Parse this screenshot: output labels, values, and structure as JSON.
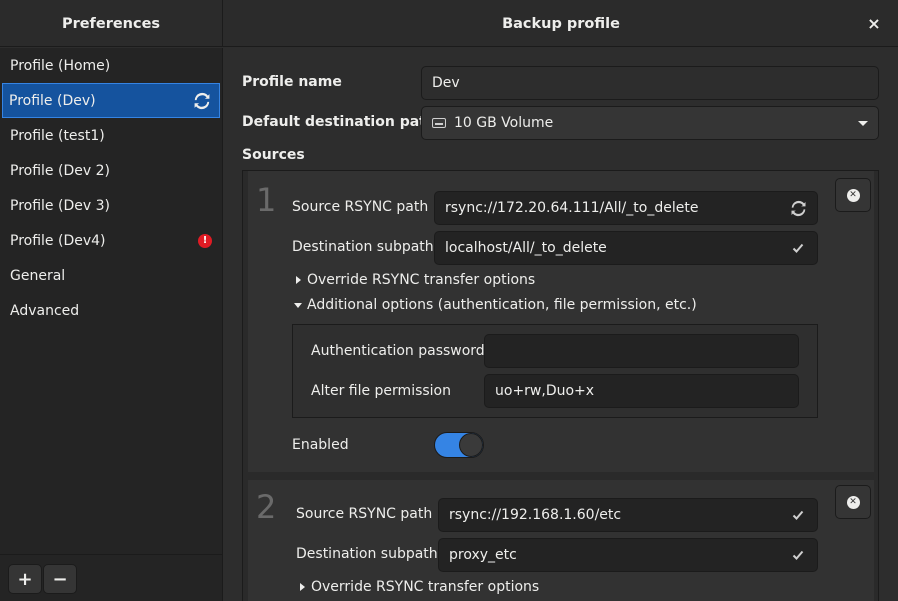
{
  "window": {
    "sidebar_title": "Preferences",
    "main_title": "Backup profile",
    "close_label": "×"
  },
  "sidebar": {
    "items": [
      {
        "label": "Profile (Home)",
        "selected": false,
        "status": ""
      },
      {
        "label": "Profile (Dev)",
        "selected": true,
        "status": "sync-icon"
      },
      {
        "label": "Profile (test1)",
        "selected": false,
        "status": ""
      },
      {
        "label": "Profile (Dev 2)",
        "selected": false,
        "status": ""
      },
      {
        "label": "Profile (Dev 3)",
        "selected": false,
        "status": ""
      },
      {
        "label": "Profile (Dev4)",
        "selected": false,
        "status": "error-icon"
      },
      {
        "label": "General",
        "selected": false,
        "status": ""
      },
      {
        "label": "Advanced",
        "selected": false,
        "status": ""
      }
    ],
    "add_label": "+",
    "remove_label": "−",
    "error_glyph": "!"
  },
  "profile": {
    "name_label": "Profile name",
    "name_value": "Dev",
    "dest_label": "Default destination path",
    "dest_value": "10 GB Volume",
    "sources_label": "Sources"
  },
  "sources": [
    {
      "number": "1",
      "source_label": "Source RSYNC path",
      "source_value": "rsync://172.20.64.111/All/_to_delete",
      "source_status": "sync-icon",
      "dest_label": "Destination subpath",
      "dest_value": "localhost/All/_to_delete",
      "dest_status": "check-icon",
      "override_label": "Override RSYNC transfer options",
      "additional_label": "Additional options (authentication, file permission, etc.)",
      "auth_label": "Authentication password",
      "auth_value": "",
      "perm_label": "Alter file permission",
      "perm_value": "uo+rw,Duo+x",
      "enabled_label": "Enabled",
      "enabled": true
    },
    {
      "number": "2",
      "source_label": "Source RSYNC path",
      "source_value": "rsync://192.168.1.60/etc",
      "source_status": "check-icon",
      "dest_label": "Destination subpath",
      "dest_value": "proxy_etc",
      "dest_status": "check-icon",
      "override_label": "Override RSYNC transfer options"
    }
  ],
  "colors": {
    "accent": "#3584e4",
    "selection": "#15539e",
    "error": "#e01b24"
  }
}
